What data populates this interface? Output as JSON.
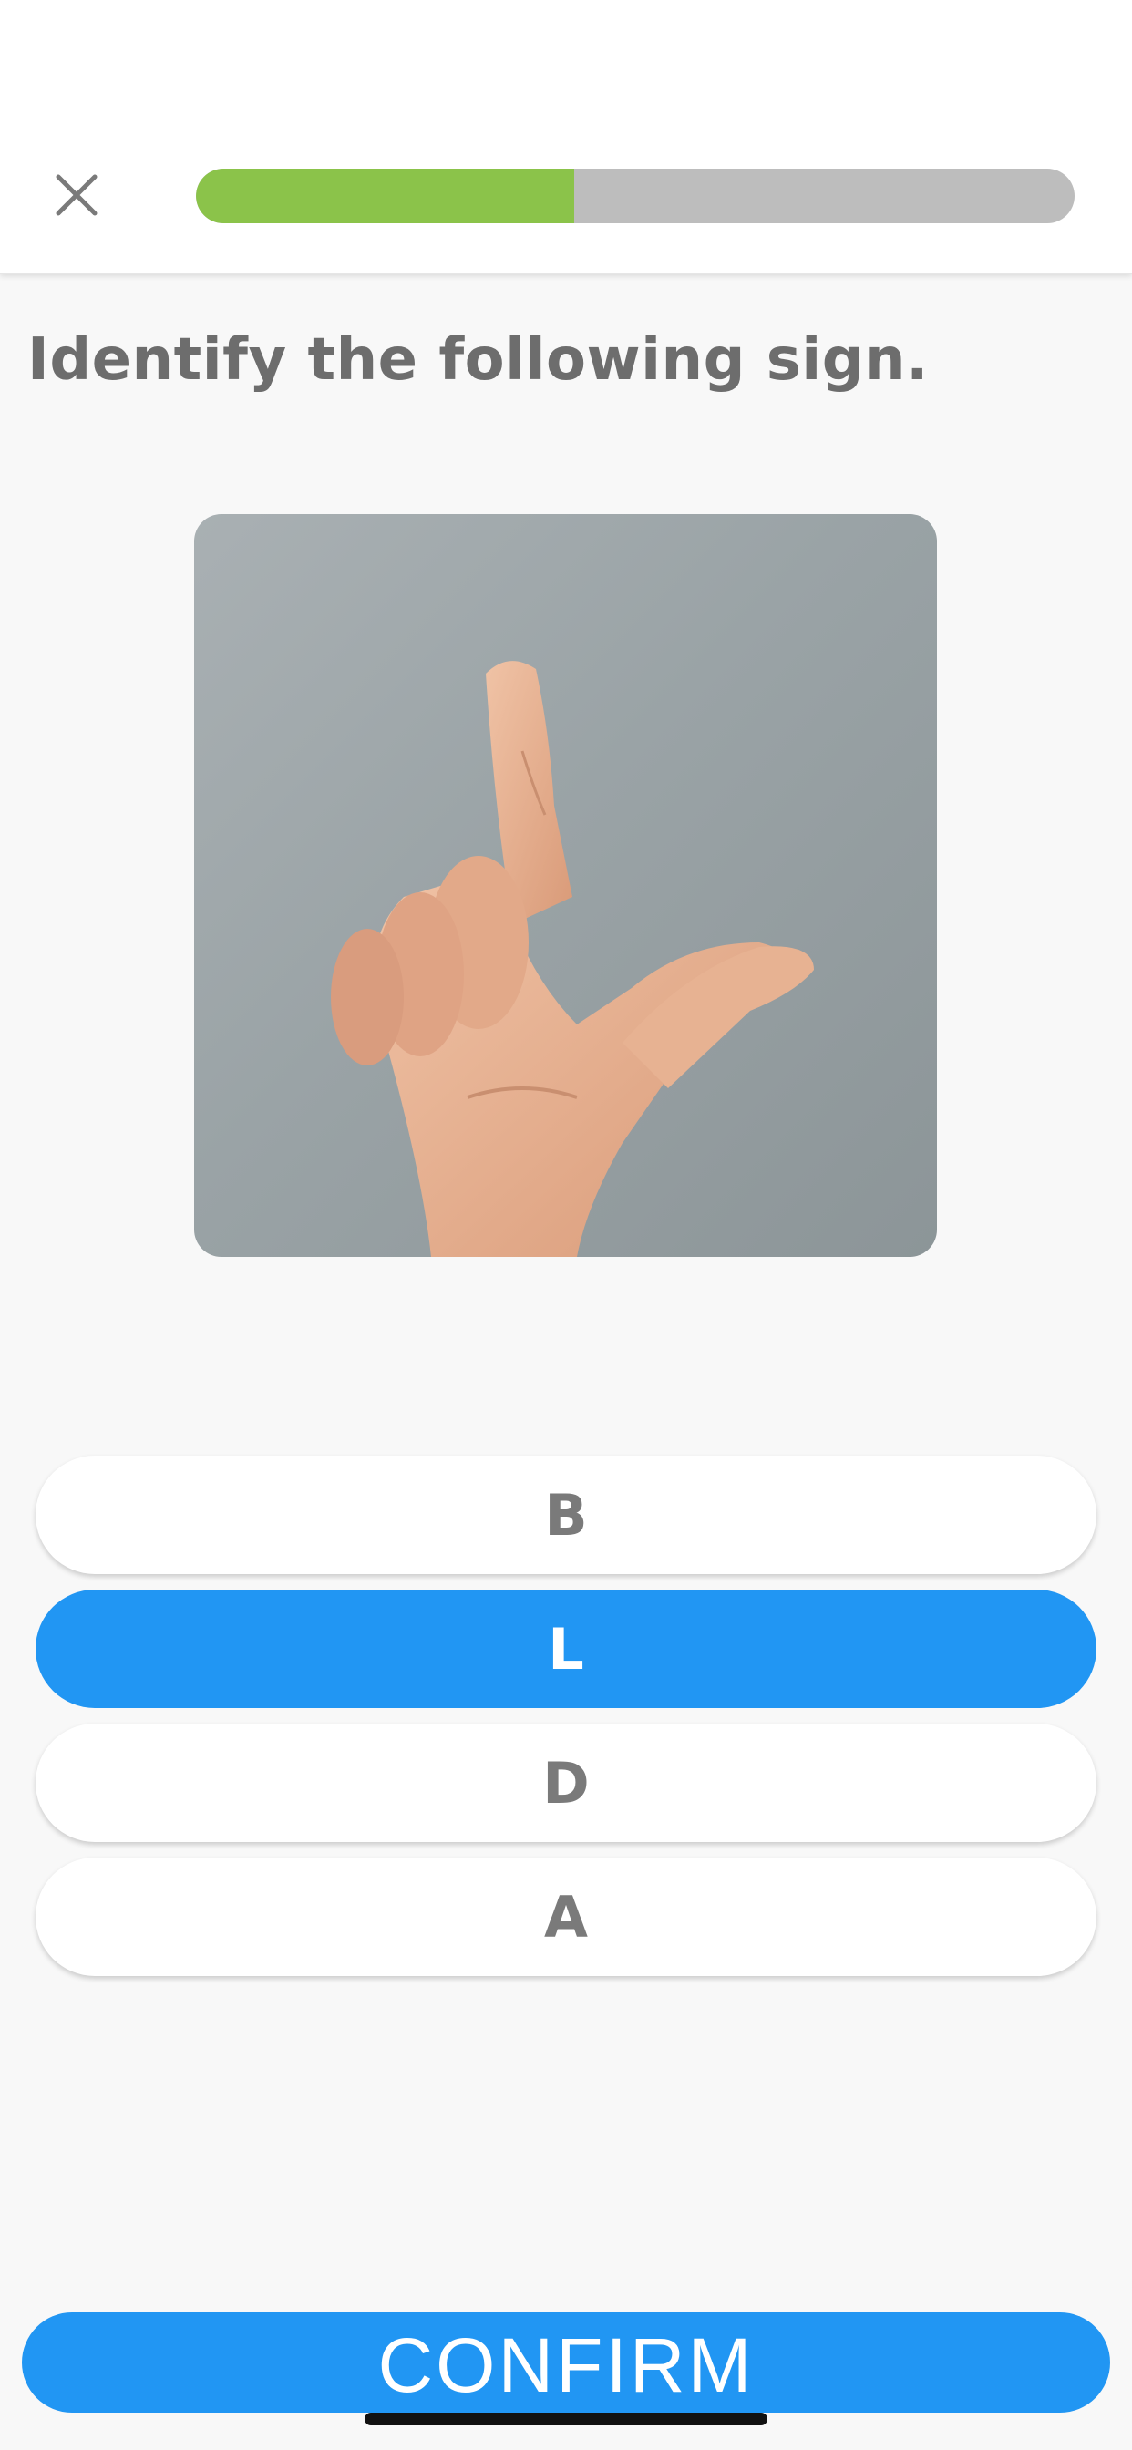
{
  "header": {
    "close_icon": "close-icon",
    "progress_fraction": 0.43,
    "progress_color": "#8bc34a",
    "track_color": "#bdbdbd"
  },
  "question": {
    "title": "Identify the following sign."
  },
  "image": {
    "description_icon": "hand-sign-l-image"
  },
  "options": [
    {
      "label": "B",
      "selected": false
    },
    {
      "label": "L",
      "selected": true
    },
    {
      "label": "D",
      "selected": false
    },
    {
      "label": "A",
      "selected": false
    }
  ],
  "confirm": {
    "label": "CONFIRM"
  },
  "colors": {
    "accent": "#2196f3",
    "text_muted": "#7a7a7a",
    "background": "#f8f8f8"
  }
}
